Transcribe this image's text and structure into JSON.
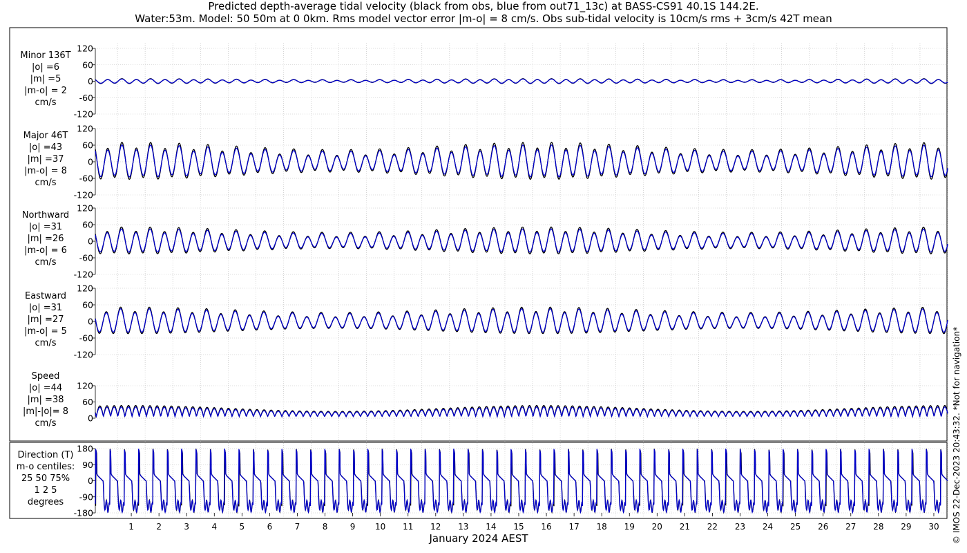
{
  "title_line1": "Predicted depth-average tidal velocity (black from obs, blue from out71_13c) at BASS-CS91 40.1S 144.2E.",
  "title_line2": "Water:53m. Model: 50 50m at 0 0km. Rms model vector error |m-o| = 8 cm/s. Obs sub-tidal velocity is 10cm/s rms + 3cm/s 42T mean",
  "copyright": "© IMOS 22-Dec-2023 20:43:32. *Not for navigation*",
  "colors": {
    "obs": "#000000",
    "model": "#0000cc",
    "grid": "#bbbbbb"
  },
  "chart_data": {
    "type": "line",
    "xlabel": "January 2024 AEST",
    "x_ticks": [
      "1",
      "2",
      "3",
      "4",
      "5",
      "6",
      "7",
      "8",
      "9",
      "10",
      "11",
      "12",
      "13",
      "14",
      "15",
      "16",
      "17",
      "18",
      "19",
      "20",
      "21",
      "22",
      "23",
      "24",
      "25",
      "26",
      "27",
      "28",
      "29",
      "30"
    ],
    "xlim_days": [
      0.2,
      31.0
    ],
    "series_names": [
      "obs (black)",
      "model (blue)"
    ],
    "panels": [
      {
        "id": "minor",
        "label": [
          "Minor 136T",
          "|o| =6",
          "|m| =5",
          "|m-o| = 2",
          "cm/s"
        ],
        "ylim": [
          -120,
          120
        ],
        "yticks": [
          "120",
          "60",
          "0",
          "-60",
          "-120"
        ],
        "obs_amplitude": 8,
        "model_amplitude": 7
      },
      {
        "id": "major",
        "label": [
          "Major 46T",
          "|o| =43",
          "|m| =37",
          "|m-o| = 8",
          "cm/s"
        ],
        "ylim": [
          -120,
          120
        ],
        "yticks": [
          "120",
          "60",
          "0",
          "-60",
          "-120"
        ],
        "obs_amplitude": 60,
        "model_amplitude": 52
      },
      {
        "id": "north",
        "label": [
          "Northward",
          "|o| =31",
          "|m| =26",
          "|m-o| = 6",
          "cm/s"
        ],
        "ylim": [
          -120,
          120
        ],
        "yticks": [
          "120",
          "60",
          "0",
          "-60",
          "-120"
        ],
        "obs_amplitude": 44,
        "model_amplitude": 38
      },
      {
        "id": "east",
        "label": [
          "Eastward",
          "|o| =31",
          "|m| =27",
          "|m-o| = 5",
          "cm/s"
        ],
        "ylim": [
          -120,
          120
        ],
        "yticks": [
          "120",
          "60",
          "0",
          "-60",
          "-120"
        ],
        "obs_amplitude": 44,
        "model_amplitude": 39
      },
      {
        "id": "speed",
        "label": [
          "Speed",
          "|o| =44",
          "|m| =38",
          "|m|-|o|= 8",
          "cm/s"
        ],
        "ylim": [
          0,
          120
        ],
        "yticks": [
          "120",
          "60",
          "0"
        ],
        "obs_amplitude": 60,
        "model_amplitude": 52
      },
      {
        "id": "direction",
        "label": [
          "Direction (T)",
          "m-o centiles:",
          "25  50  75%",
          "1  2  5",
          "degrees"
        ],
        "ylim": [
          -180,
          180
        ],
        "yticks": [
          "180",
          "90",
          "0",
          "-90",
          "-180"
        ]
      }
    ]
  }
}
